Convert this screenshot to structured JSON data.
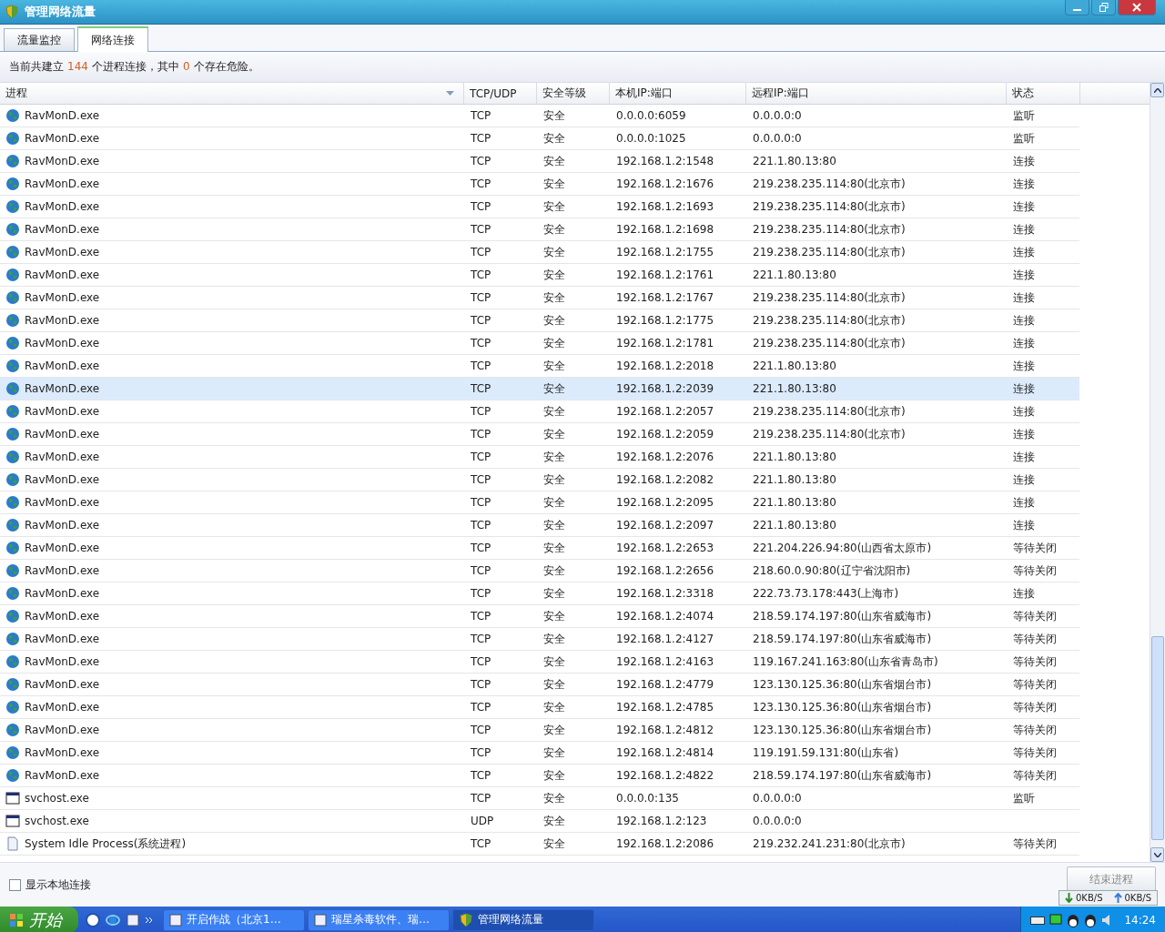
{
  "window": {
    "title": "管理网络流量"
  },
  "tabs": [
    {
      "label": "流量监控",
      "selected": false
    },
    {
      "label": "网络连接",
      "selected": true
    }
  ],
  "summary": {
    "before": "当前共建立",
    "count": "144",
    "middle": "个进程连接，其中",
    "danger": "0",
    "after": "个存在危险。"
  },
  "table": {
    "columns": [
      "进程",
      "TCP/UDP",
      "安全等级",
      "本机IP:端口",
      "远程IP:端口",
      "状态"
    ],
    "rows": [
      {
        "kind": "globe",
        "process": "RavMonD.exe",
        "protocol": "TCP",
        "security": "安全",
        "local": "0.0.0.0:6059",
        "remote": "0.0.0.0:0",
        "state": "监听",
        "selected": false
      },
      {
        "kind": "globe",
        "process": "RavMonD.exe",
        "protocol": "TCP",
        "security": "安全",
        "local": "0.0.0.0:1025",
        "remote": "0.0.0.0:0",
        "state": "监听",
        "selected": false
      },
      {
        "kind": "globe",
        "process": "RavMonD.exe",
        "protocol": "TCP",
        "security": "安全",
        "local": "192.168.1.2:1548",
        "remote": "221.1.80.13:80",
        "state": "连接",
        "selected": false
      },
      {
        "kind": "globe",
        "process": "RavMonD.exe",
        "protocol": "TCP",
        "security": "安全",
        "local": "192.168.1.2:1676",
        "remote": "219.238.235.114:80(北京市)",
        "state": "连接",
        "selected": false
      },
      {
        "kind": "globe",
        "process": "RavMonD.exe",
        "protocol": "TCP",
        "security": "安全",
        "local": "192.168.1.2:1693",
        "remote": "219.238.235.114:80(北京市)",
        "state": "连接",
        "selected": false
      },
      {
        "kind": "globe",
        "process": "RavMonD.exe",
        "protocol": "TCP",
        "security": "安全",
        "local": "192.168.1.2:1698",
        "remote": "219.238.235.114:80(北京市)",
        "state": "连接",
        "selected": false
      },
      {
        "kind": "globe",
        "process": "RavMonD.exe",
        "protocol": "TCP",
        "security": "安全",
        "local": "192.168.1.2:1755",
        "remote": "219.238.235.114:80(北京市)",
        "state": "连接",
        "selected": false
      },
      {
        "kind": "globe",
        "process": "RavMonD.exe",
        "protocol": "TCP",
        "security": "安全",
        "local": "192.168.1.2:1761",
        "remote": "221.1.80.13:80",
        "state": "连接",
        "selected": false
      },
      {
        "kind": "globe",
        "process": "RavMonD.exe",
        "protocol": "TCP",
        "security": "安全",
        "local": "192.168.1.2:1767",
        "remote": "219.238.235.114:80(北京市)",
        "state": "连接",
        "selected": false
      },
      {
        "kind": "globe",
        "process": "RavMonD.exe",
        "protocol": "TCP",
        "security": "安全",
        "local": "192.168.1.2:1775",
        "remote": "219.238.235.114:80(北京市)",
        "state": "连接",
        "selected": false
      },
      {
        "kind": "globe",
        "process": "RavMonD.exe",
        "protocol": "TCP",
        "security": "安全",
        "local": "192.168.1.2:1781",
        "remote": "219.238.235.114:80(北京市)",
        "state": "连接",
        "selected": false
      },
      {
        "kind": "globe",
        "process": "RavMonD.exe",
        "protocol": "TCP",
        "security": "安全",
        "local": "192.168.1.2:2018",
        "remote": "221.1.80.13:80",
        "state": "连接",
        "selected": false
      },
      {
        "kind": "globe",
        "process": "RavMonD.exe",
        "protocol": "TCP",
        "security": "安全",
        "local": "192.168.1.2:2039",
        "remote": "221.1.80.13:80",
        "state": "连接",
        "selected": true
      },
      {
        "kind": "globe",
        "process": "RavMonD.exe",
        "protocol": "TCP",
        "security": "安全",
        "local": "192.168.1.2:2057",
        "remote": "219.238.235.114:80(北京市)",
        "state": "连接",
        "selected": false
      },
      {
        "kind": "globe",
        "process": "RavMonD.exe",
        "protocol": "TCP",
        "security": "安全",
        "local": "192.168.1.2:2059",
        "remote": "219.238.235.114:80(北京市)",
        "state": "连接",
        "selected": false
      },
      {
        "kind": "globe",
        "process": "RavMonD.exe",
        "protocol": "TCP",
        "security": "安全",
        "local": "192.168.1.2:2076",
        "remote": "221.1.80.13:80",
        "state": "连接",
        "selected": false
      },
      {
        "kind": "globe",
        "process": "RavMonD.exe",
        "protocol": "TCP",
        "security": "安全",
        "local": "192.168.1.2:2082",
        "remote": "221.1.80.13:80",
        "state": "连接",
        "selected": false
      },
      {
        "kind": "globe",
        "process": "RavMonD.exe",
        "protocol": "TCP",
        "security": "安全",
        "local": "192.168.1.2:2095",
        "remote": "221.1.80.13:80",
        "state": "连接",
        "selected": false
      },
      {
        "kind": "globe",
        "process": "RavMonD.exe",
        "protocol": "TCP",
        "security": "安全",
        "local": "192.168.1.2:2097",
        "remote": "221.1.80.13:80",
        "state": "连接",
        "selected": false
      },
      {
        "kind": "globe",
        "process": "RavMonD.exe",
        "protocol": "TCP",
        "security": "安全",
        "local": "192.168.1.2:2653",
        "remote": "221.204.226.94:80(山西省太原市)",
        "state": "等待关闭",
        "selected": false
      },
      {
        "kind": "globe",
        "process": "RavMonD.exe",
        "protocol": "TCP",
        "security": "安全",
        "local": "192.168.1.2:2656",
        "remote": "218.60.0.90:80(辽宁省沈阳市)",
        "state": "等待关闭",
        "selected": false
      },
      {
        "kind": "globe",
        "process": "RavMonD.exe",
        "protocol": "TCP",
        "security": "安全",
        "local": "192.168.1.2:3318",
        "remote": "222.73.73.178:443(上海市)",
        "state": "连接",
        "selected": false
      },
      {
        "kind": "globe",
        "process": "RavMonD.exe",
        "protocol": "TCP",
        "security": "安全",
        "local": "192.168.1.2:4074",
        "remote": "218.59.174.197:80(山东省威海市)",
        "state": "等待关闭",
        "selected": false
      },
      {
        "kind": "globe",
        "process": "RavMonD.exe",
        "protocol": "TCP",
        "security": "安全",
        "local": "192.168.1.2:4127",
        "remote": "218.59.174.197:80(山东省威海市)",
        "state": "等待关闭",
        "selected": false
      },
      {
        "kind": "globe",
        "process": "RavMonD.exe",
        "protocol": "TCP",
        "security": "安全",
        "local": "192.168.1.2:4163",
        "remote": "119.167.241.163:80(山东省青岛市)",
        "state": "等待关闭",
        "selected": false
      },
      {
        "kind": "globe",
        "process": "RavMonD.exe",
        "protocol": "TCP",
        "security": "安全",
        "local": "192.168.1.2:4779",
        "remote": "123.130.125.36:80(山东省烟台市)",
        "state": "等待关闭",
        "selected": false
      },
      {
        "kind": "globe",
        "process": "RavMonD.exe",
        "protocol": "TCP",
        "security": "安全",
        "local": "192.168.1.2:4785",
        "remote": "123.130.125.36:80(山东省烟台市)",
        "state": "等待关闭",
        "selected": false
      },
      {
        "kind": "globe",
        "process": "RavMonD.exe",
        "protocol": "TCP",
        "security": "安全",
        "local": "192.168.1.2:4812",
        "remote": "123.130.125.36:80(山东省烟台市)",
        "state": "等待关闭",
        "selected": false
      },
      {
        "kind": "globe",
        "process": "RavMonD.exe",
        "protocol": "TCP",
        "security": "安全",
        "local": "192.168.1.2:4814",
        "remote": "119.191.59.131:80(山东省)",
        "state": "等待关闭",
        "selected": false
      },
      {
        "kind": "globe",
        "process": "RavMonD.exe",
        "protocol": "TCP",
        "security": "安全",
        "local": "192.168.1.2:4822",
        "remote": "218.59.174.197:80(山东省威海市)",
        "state": "等待关闭",
        "selected": false
      },
      {
        "kind": "window",
        "process": "svchost.exe",
        "protocol": "TCP",
        "security": "安全",
        "local": "0.0.0.0:135",
        "remote": "0.0.0.0:0",
        "state": "监听",
        "selected": false
      },
      {
        "kind": "window",
        "process": "svchost.exe",
        "protocol": "UDP",
        "security": "安全",
        "local": "192.168.1.2:123",
        "remote": "0.0.0.0:0",
        "selected": false
      },
      {
        "kind": "file",
        "process": "System Idle Process(系统进程)",
        "protocol": "TCP",
        "security": "安全",
        "local": "192.168.1.2:2086",
        "remote": "219.232.241.231:80(北京市)",
        "state": "等待关闭",
        "selected": false
      }
    ]
  },
  "show_local": {
    "label": "显示本地连接",
    "checked": false
  },
  "end_button": "结束进程",
  "speed": {
    "down": "0KB/S",
    "up": "0KB/S"
  },
  "taskbar": {
    "start": "开始",
    "tasks": [
      {
        "label": "开启作战（北京1…",
        "selected": false
      },
      {
        "label": "瑞星杀毒软件、瑞…",
        "selected": false
      },
      {
        "label": "管理网络流量",
        "selected": true
      }
    ],
    "clock": "14:24"
  }
}
